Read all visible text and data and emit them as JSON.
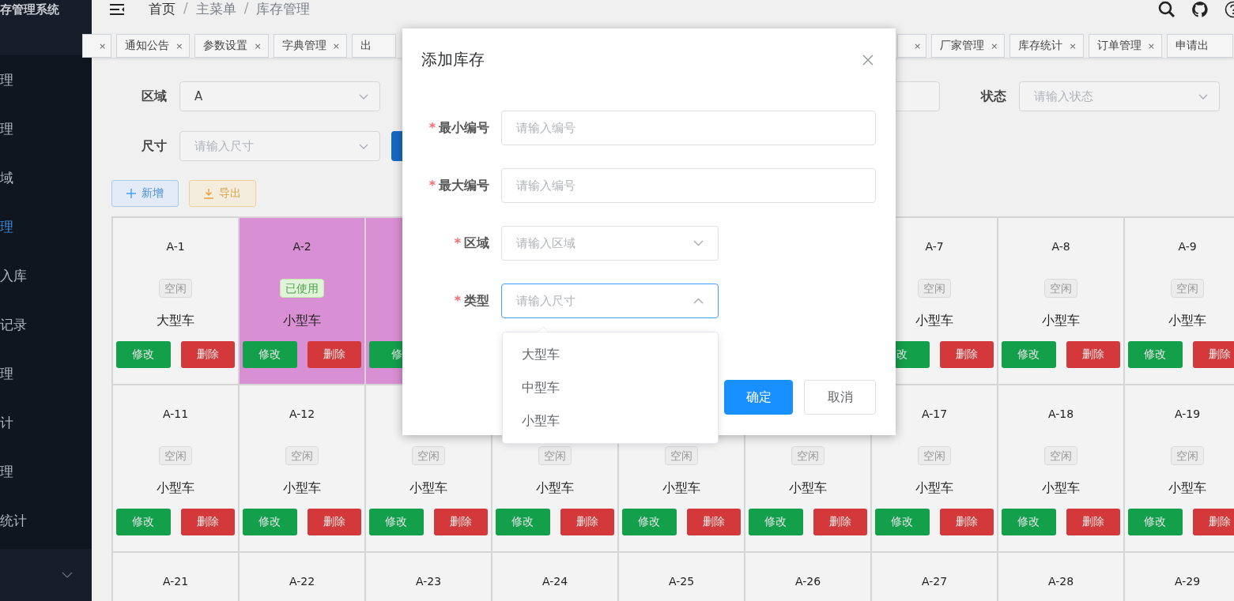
{
  "sidebar": {
    "title": "存管理系统",
    "items": [
      {
        "label": "理",
        "selected": false
      },
      {
        "label": "理",
        "selected": false
      },
      {
        "label": "域",
        "selected": false
      },
      {
        "label": "理",
        "selected": true
      },
      {
        "label": "入库",
        "selected": false
      },
      {
        "label": "记录",
        "selected": false
      },
      {
        "label": "理",
        "selected": false
      },
      {
        "label": "计",
        "selected": false
      },
      {
        "label": "理",
        "selected": false
      },
      {
        "label": "统计",
        "selected": false
      }
    ]
  },
  "breadcrumb": [
    {
      "label": "首页"
    },
    {
      "separator": "/",
      "label": "主菜单"
    },
    {
      "separator": "/",
      "label": "库存管理"
    }
  ],
  "tabs_left": [
    {
      "kind": "tail",
      "close": "×"
    },
    {
      "kind": "tab",
      "label": "通知公告",
      "close": "×"
    },
    {
      "kind": "tab",
      "label": "参数设置",
      "close": "×"
    },
    {
      "kind": "tab",
      "label": "字典管理",
      "close": "×"
    },
    {
      "kind": "cut",
      "label": "出"
    }
  ],
  "tabs_right": [
    {
      "kind": "tail",
      "close": "×"
    },
    {
      "kind": "tab",
      "label": "厂家管理",
      "close": "×"
    },
    {
      "kind": "tab",
      "label": "库存统计",
      "close": "×"
    },
    {
      "kind": "tab",
      "label": "订单管理",
      "close": "×"
    },
    {
      "kind": "cut",
      "label": "申请出"
    }
  ],
  "filters": [
    {
      "kind": "select",
      "label": "区域",
      "value": "A"
    },
    {
      "kind": "covered"
    },
    {
      "kind": "field"
    },
    {
      "kind": "select",
      "label": "状态",
      "placeholder": "请输入状态"
    },
    {
      "kind": "select",
      "label": "尺寸",
      "placeholder": "请输入尺寸"
    },
    {
      "kind": "button"
    }
  ],
  "toolbar": [
    {
      "kind": "add",
      "label": "新增"
    },
    {
      "kind": "export",
      "label": "导出"
    }
  ],
  "grid": {
    "rows": [
      [
        {
          "code": "A-1",
          "used": false,
          "status": "空闲",
          "type": "大型车",
          "edit": "修改",
          "delete": "删除"
        },
        {
          "code": "A-2",
          "used": true,
          "status": "已使用",
          "type": "小型车",
          "edit": "修改",
          "delete": "删除"
        },
        {
          "used": true,
          "edit": "修"
        },
        {},
        {},
        {},
        {
          "code": "A-7",
          "used": false,
          "status": "空闲",
          "type": "小型车",
          "edit": "改",
          "delete": "删除"
        },
        {
          "code": "A-8",
          "used": false,
          "status": "空闲",
          "type": "小型车",
          "edit": "修改",
          "delete": "删除"
        },
        {
          "code": "A-9",
          "used": false,
          "status": "空闲",
          "type": "小型车",
          "edit": "修改",
          "delete": "删除"
        }
      ],
      [
        {
          "code": "A-11",
          "used": false,
          "status": "空闲",
          "type": "小型车",
          "edit": "修改",
          "delete": "删除"
        },
        {
          "code": "A-12",
          "used": false,
          "status": "空闲",
          "type": "小型车",
          "edit": "修改",
          "delete": "删除"
        },
        {
          "used": false,
          "status": "空闲",
          "type": "小型车",
          "edit": "修改",
          "delete": "删除"
        },
        {
          "used": false,
          "status": "空闲",
          "type": "小型车",
          "edit": "修改",
          "delete": "删除"
        },
        {
          "used": false,
          "status": "空闲",
          "type": "小型车",
          "edit": "修改",
          "delete": "删除"
        },
        {
          "used": false,
          "status": "空闲",
          "type": "小型车",
          "edit": "修改",
          "delete": "删除"
        },
        {
          "code": "A-17",
          "used": false,
          "status": "空闲",
          "type": "小型车",
          "edit": "修改",
          "delete": "删除"
        },
        {
          "code": "A-18",
          "used": false,
          "status": "空闲",
          "type": "小型车",
          "edit": "修改",
          "delete": "删除"
        },
        {
          "code": "A-19",
          "used": false,
          "status": "空闲",
          "type": "小型车",
          "edit": "修改",
          "delete": "删除"
        }
      ],
      [
        {
          "code": "A-21",
          "used": false
        },
        {
          "code": "A-22",
          "used": false
        },
        {
          "code": "A-23",
          "used": false
        },
        {
          "code": "A-24",
          "used": false
        },
        {
          "code": "A-25",
          "used": false
        },
        {
          "code": "A-26",
          "used": false
        },
        {
          "code": "A-27",
          "used": false
        },
        {
          "code": "A-28",
          "used": false
        },
        {
          "code": "A-29",
          "used": false
        }
      ]
    ]
  },
  "dialog": {
    "title": "添加库存",
    "fields": [
      {
        "kind": "input",
        "mark": "*",
        "label": "最小编号",
        "placeholder": "请输入编号",
        "focused": false
      },
      {
        "kind": "input",
        "mark": "*",
        "label": "最大编号",
        "placeholder": "请输入编号",
        "focused": false
      },
      {
        "kind": "select",
        "mark": "*",
        "label": "区域",
        "placeholder": "请输入区域",
        "focused": false
      },
      {
        "kind": "select",
        "mark": "*",
        "label": "类型",
        "placeholder": "请输入尺寸",
        "focused": true
      }
    ],
    "options": [
      "大型车",
      "中型车",
      "小型车"
    ],
    "buttons": [
      {
        "kind": "primary",
        "label": "确定"
      },
      {
        "kind": "default",
        "label": "取消"
      }
    ]
  }
}
